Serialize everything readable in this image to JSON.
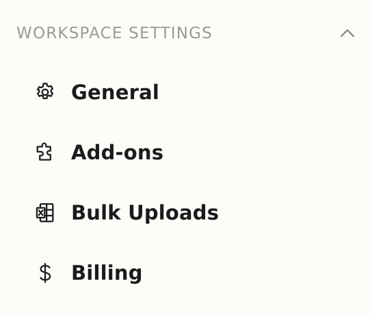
{
  "section": {
    "title": "WORKSPACE SETTINGS",
    "collapse_icon": "chevron-up-icon"
  },
  "nav": {
    "items": [
      {
        "label": "General",
        "icon": "gear-icon"
      },
      {
        "label": "Add-ons",
        "icon": "puzzle-icon"
      },
      {
        "label": "Bulk Uploads",
        "icon": "spreadsheet-icon"
      },
      {
        "label": "Billing",
        "icon": "dollar-icon"
      }
    ]
  },
  "colors": {
    "background": "#fcfcf8",
    "header_text": "#9a9a9a",
    "item_text": "#1b1b1b",
    "icon_stroke": "#1d1d1d"
  }
}
